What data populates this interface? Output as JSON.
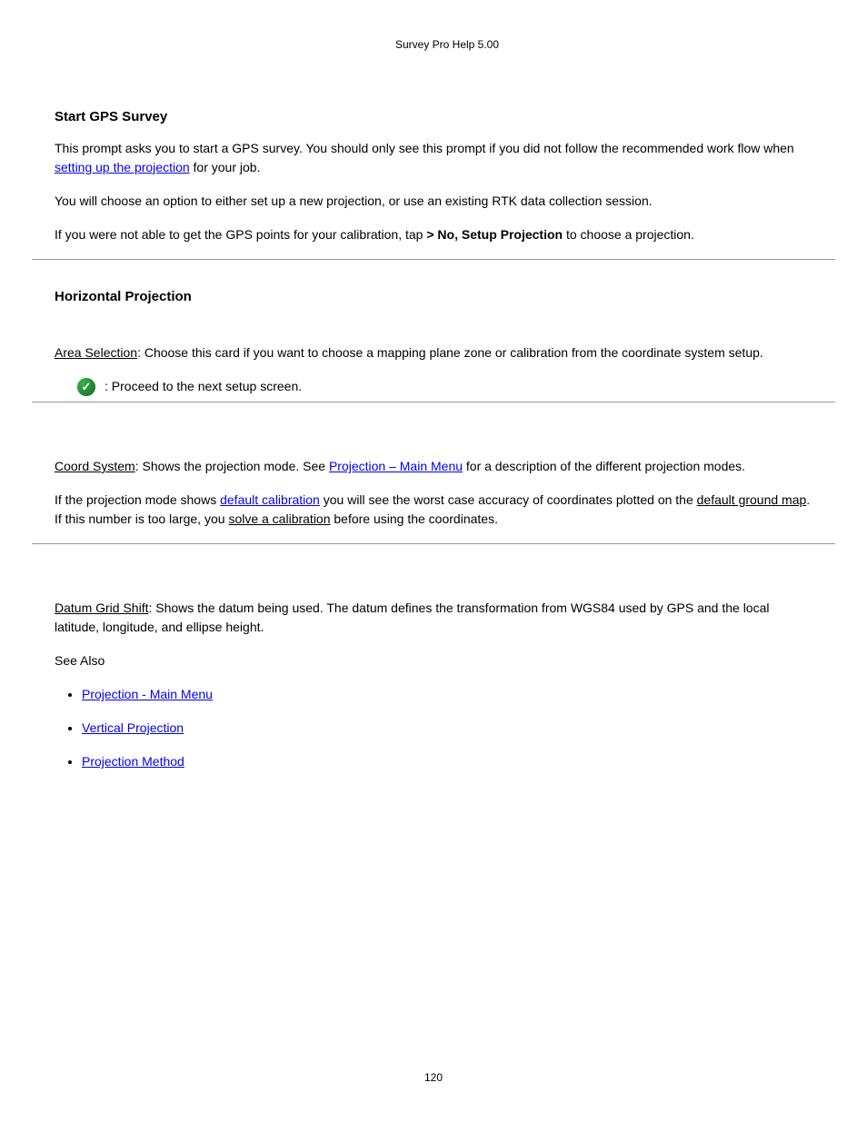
{
  "header": "Survey Pro Help 5.00",
  "s1": {
    "title": "Start GPS Survey",
    "p1_a": "This prompt asks you to start a GPS survey. You should only see this prompt if you did not follow the recommended work flow when ",
    "p1_link": "setting up the projection",
    "p1_b": " for your job.",
    "p2": "You will choose an option to either set up a new projection, or use an existing RTK data collection session.",
    "p3_a": "If you were not able to get the GPS points for your calibration, tap ",
    "p3_b": "  to choose a projection."
  },
  "s2": {
    "title": "Horizontal Projection",
    "area": "Area Selection",
    "p1": ": Choose this card if you want to choose a mapping plane zone or calibration from the coordinate system setup.",
    "check_text": ": Proceed to the next setup screen.",
    "hr": " ",
    "cs_label": "Coord System",
    "cs_a": ": Shows the projection mode. See ",
    "cs_link": "Projection – Main Menu",
    "cs_b": " for a description of the different projection modes.",
    "cs2_a": "If the projection mode shows ",
    "cs2_link": "default calibration",
    "cs2_b": " you will see the worst case accuracy of coordinates plotted on the ",
    "cs2_u": "default ground map",
    "cs2_c": ". If this number is too large, you ",
    "cs2_u2": "solve a calibration",
    "cs2_d": " before using the coordinates.",
    "hr2": " ",
    "dgs_label": "Datum Grid Shift",
    "dgs_text": ": Shows the datum being used. The datum defines the transformation from WGS84 used by GPS and the local latitude, longitude, and ellipse height.",
    "see": "See Also"
  },
  "links": {
    "l1": "Projection - Main Menu",
    "l2": "Vertical Projection",
    "l3": "Projection Method"
  },
  "page_no": "120"
}
